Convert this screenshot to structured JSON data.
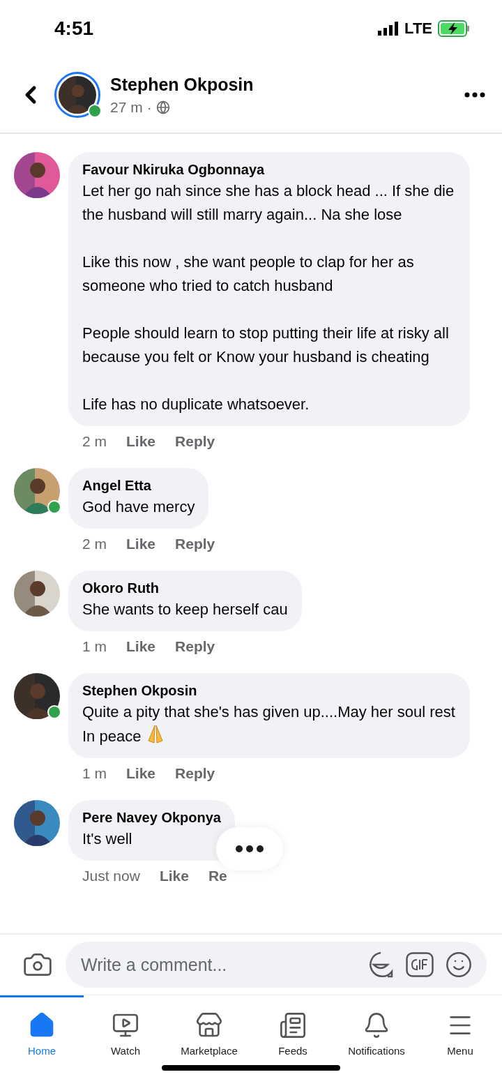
{
  "status_bar": {
    "time": "4:51",
    "network": "LTE"
  },
  "header": {
    "name": "Stephen Okposin",
    "age": "27 m",
    "separator": "·",
    "online": true
  },
  "comments": [
    {
      "author": "Favour Nkiruka Ogbonnaya",
      "online": false,
      "paragraphs": [
        "Let her go nah since she has a block head ... If she die the husband will still marry again... Na she lose",
        "Like this now , she want people to clap for her as someone who tried to catch husband",
        "People should learn to stop putting their life at risky all because you felt or Know your husband is cheating",
        "Life has no duplicate whatsoever."
      ],
      "time": "2 m",
      "like": "Like",
      "reply": "Reply",
      "emoji": false,
      "typing": false
    },
    {
      "author": "Angel Etta",
      "online": true,
      "paragraphs": [
        "God have mercy"
      ],
      "time": "2 m",
      "like": "Like",
      "reply": "Reply",
      "emoji": false,
      "typing": false
    },
    {
      "author": "Okoro Ruth",
      "online": false,
      "paragraphs": [
        "She wants to keep herself cau"
      ],
      "time": "1 m",
      "like": "Like",
      "reply": "Reply",
      "emoji": false,
      "typing": false
    },
    {
      "author": "Stephen Okposin",
      "online": true,
      "paragraphs": [
        "Quite a pity that she's has given up....May her soul rest In peace"
      ],
      "time": "1 m",
      "like": "Like",
      "reply": "Reply",
      "emoji": true,
      "typing": false
    },
    {
      "author": "Pere Navey Okponya",
      "online": false,
      "paragraphs": [
        "It's well"
      ],
      "time": "Just now",
      "like": "Like",
      "reply": "Re",
      "emoji": false,
      "typing": true
    }
  ],
  "composer": {
    "placeholder": "Write a comment..."
  },
  "tabs": [
    {
      "label": "Home",
      "kind": "home",
      "selected": true
    },
    {
      "label": "Watch",
      "kind": "watch",
      "selected": false
    },
    {
      "label": "Marketplace",
      "kind": "marketplace",
      "selected": false
    },
    {
      "label": "Feeds",
      "kind": "feeds",
      "selected": false
    },
    {
      "label": "Notifications",
      "kind": "notifications",
      "selected": false
    },
    {
      "label": "Menu",
      "kind": "menu",
      "selected": false
    }
  ]
}
